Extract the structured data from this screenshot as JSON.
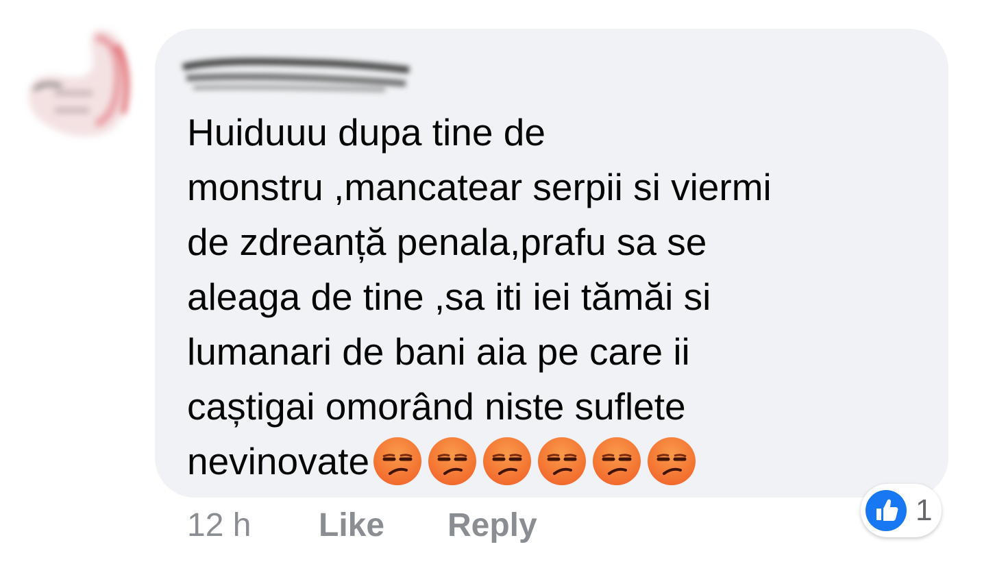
{
  "comment": {
    "lines": [
      "Huiduuu dupa tine de",
      "monstru ,mancatear serpii si viermi",
      "de zdreanță penala,prafu sa se",
      "aleaga de tine ,sa iti iei tămăi si",
      "lumanari de bani aia pe care ii",
      "caștigai omorând niste suflete",
      "nevinovate"
    ],
    "emojis": [
      "unamused-face-icon",
      "unamused-face-icon",
      "unamused-face-icon",
      "unamused-face-icon",
      "unamused-face-icon",
      "unamused-face-icon"
    ]
  },
  "footer": {
    "time": "12 h",
    "like_label": "Like",
    "reply_label": "Reply"
  },
  "reactions": {
    "icon": "thumbs-up-icon",
    "count": "1"
  },
  "colors": {
    "bubble": "#f0f2f5",
    "text": "#050505",
    "muted": "#8a8d91",
    "like_blue": "#1877f2",
    "emoji_orange": "#f26a2c"
  }
}
